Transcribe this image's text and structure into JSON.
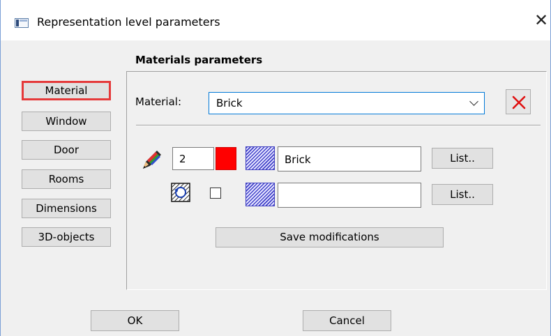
{
  "window": {
    "title": "Representation level parameters",
    "close_symbol": "✕"
  },
  "section_title": "Materials parameters",
  "sidebar": {
    "items": [
      {
        "label": "Material",
        "selected": true
      },
      {
        "label": "Window",
        "selected": false
      },
      {
        "label": "Door",
        "selected": false
      },
      {
        "label": "Rooms",
        "selected": false
      },
      {
        "label": "Dimensions",
        "selected": false
      },
      {
        "label": "3D-objects",
        "selected": false
      }
    ]
  },
  "material": {
    "label": "Material:",
    "selected_value": "Brick"
  },
  "pen_row": {
    "pen_number": "2",
    "pen_color": "#ff0000",
    "hatch_name": "Brick",
    "list_label": "List.."
  },
  "fill_row": {
    "checkbox_checked": false,
    "hatch_name": "",
    "list_label": "List.."
  },
  "actions": {
    "save_label": "Save modifications"
  },
  "footer": {
    "ok_label": "OK",
    "cancel_label": "Cancel"
  },
  "icons": {
    "app": "app-window-icon",
    "close": "close-icon",
    "delete": "red-x-delete-icon",
    "pencil": "colored-pencil-icon",
    "pattern": "hatch-pattern-refresh-icon",
    "dropdown": "chevron-down-icon"
  },
  "colors": {
    "selected_border": "#e5393a",
    "focus_border": "#0078d7",
    "hatch": "#4040c8"
  }
}
